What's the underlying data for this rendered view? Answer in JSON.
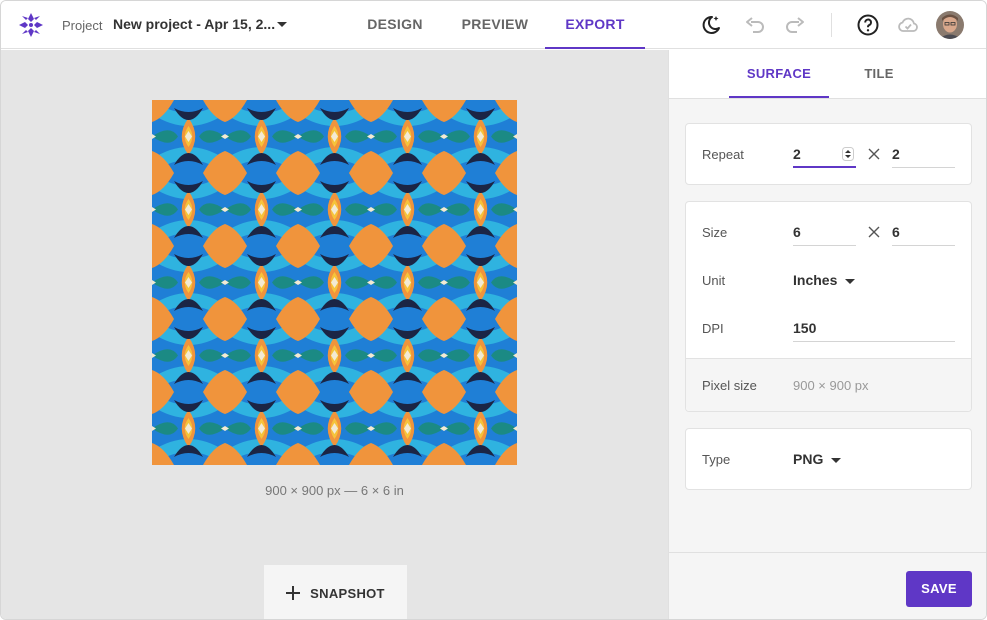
{
  "header": {
    "project_label": "Project",
    "project_name": "New project - Apr 15, 2...",
    "tabs": [
      {
        "label": "DESIGN",
        "active": false
      },
      {
        "label": "PREVIEW",
        "active": false
      },
      {
        "label": "EXPORT",
        "active": true
      }
    ],
    "icons": [
      "theme-moon-icon",
      "undo-icon",
      "redo-icon",
      "help-icon",
      "cloud-icon",
      "avatar"
    ],
    "accent_color": "#5f37c6"
  },
  "canvas": {
    "caption": "900 × 900 px — 6 × 6 in",
    "snapshot_label": "SNAPSHOT",
    "background": "#e5e5e5"
  },
  "panel": {
    "tabs": [
      {
        "label": "SURFACE",
        "active": true
      },
      {
        "label": "TILE",
        "active": false
      }
    ],
    "repeat": {
      "label": "Repeat",
      "x": "2",
      "y": "2"
    },
    "size": {
      "label": "Size",
      "x": "6",
      "y": "6"
    },
    "unit": {
      "label": "Unit",
      "value": "Inches"
    },
    "dpi": {
      "label": "DPI",
      "value": "150"
    },
    "pixel_size": {
      "label": "Pixel size",
      "value": "900 × 900 px"
    },
    "type": {
      "label": "Type",
      "value": "PNG"
    },
    "save_label": "SAVE"
  }
}
